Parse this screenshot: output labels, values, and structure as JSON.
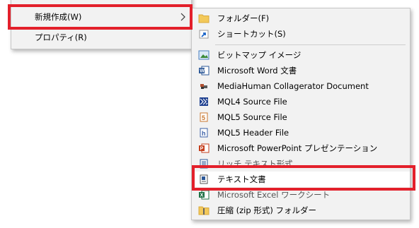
{
  "parent_menu": {
    "items": [
      {
        "label": "新規作成(W)"
      },
      {
        "label": "プロパティ(R)"
      }
    ]
  },
  "sub_menu": {
    "items": [
      {
        "label": "フォルダー(F)",
        "icon": "folder-icon"
      },
      {
        "label": "ショートカット(S)",
        "icon": "shortcut-icon"
      },
      {
        "label": "ビットマップ イメージ",
        "icon": "bitmap-image-icon"
      },
      {
        "label": "Microsoft Word 文書",
        "icon": "word-document-icon"
      },
      {
        "label": "MediaHuman Collagerator Document",
        "icon": "collagerator-icon"
      },
      {
        "label": "MQL4 Source File",
        "icon": "mql4-source-icon"
      },
      {
        "label": "MQL5 Source File",
        "icon": "mql5-source-icon"
      },
      {
        "label": "MQL5 Header File",
        "icon": "mql5-header-icon"
      },
      {
        "label": "Microsoft PowerPoint プレゼンテーション",
        "icon": "powerpoint-icon"
      },
      {
        "label": "リッチ テキスト形式",
        "icon": "rich-text-icon"
      },
      {
        "label": "テキスト文書",
        "icon": "text-document-icon"
      },
      {
        "label": "Microsoft Excel ワークシート",
        "icon": "excel-icon"
      },
      {
        "label": "圧縮 (zip 形式) フォルダー",
        "icon": "zip-folder-icon"
      }
    ]
  },
  "colors": {
    "highlight": "#e3202b",
    "menu_bg": "#f2f2f2"
  }
}
